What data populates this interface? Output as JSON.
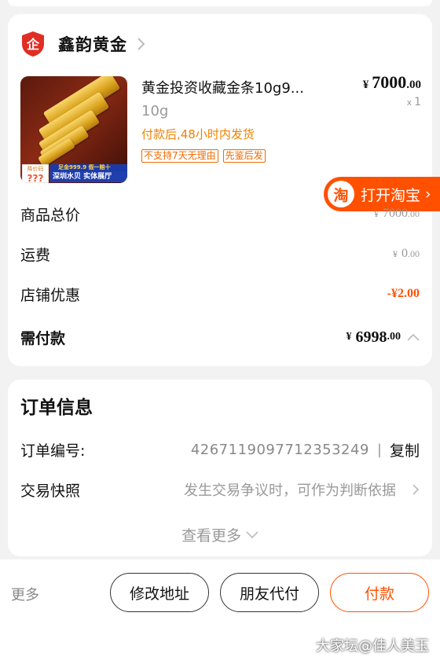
{
  "shop": {
    "logo_text": "企",
    "name": "鑫韵黄金"
  },
  "product": {
    "thumb_price_tag_label": "降价码",
    "thumb_price_tag_value": "???",
    "thumb_band_top": "足金999.9 假一赔十",
    "thumb_band_bottom": "深圳水贝 实体展厅",
    "title": "黄金投资收藏金条10g9...",
    "spec": "10g",
    "shipping": "付款后,48小时内发货",
    "tags": [
      "不支持7天无理由",
      "先鉴后发"
    ],
    "price_currency": "¥",
    "price_int": "7000",
    "price_dec": ".00",
    "qty_x": "x",
    "qty": "1"
  },
  "open_taobao": {
    "icon_text": "淘",
    "label": "打开淘宝",
    "chevron": "›"
  },
  "summary": {
    "total_label": "商品总价",
    "total_cur": "¥",
    "total_int": "7000",
    "total_dec": ".00",
    "freight_label": "运费",
    "freight_cur": "¥",
    "freight_int": "0",
    "freight_dec": ".00",
    "discount_label": "店铺优惠",
    "discount_value": "-¥2.00",
    "pay_label": "需付款",
    "pay_cur": "¥",
    "pay_int": "6998",
    "pay_dec": ".00"
  },
  "order": {
    "title": "订单信息",
    "number_label": "订单编号:",
    "number_value": "4267119097712353249",
    "separator": "|",
    "copy_label": "复制",
    "snapshot_label": "交易快照",
    "snapshot_value": "发生交易争议时，可作为判断依据",
    "see_more": "查看更多"
  },
  "bottom": {
    "more": "更多",
    "modify_address": "修改地址",
    "friend_pay": "朋友代付",
    "pay": "付款",
    "watermark": "大家坛@佳人美玉"
  },
  "colors": {
    "accent": "#ff5000",
    "shipping_text": "#f08200",
    "shop_logo_red": "#e02e24"
  }
}
